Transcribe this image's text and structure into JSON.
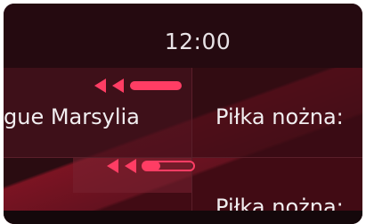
{
  "header": {
    "time": "12:00"
  },
  "programs": [
    {
      "title": "gue Marsylia",
      "status_icon": "rewind-icon",
      "progress": 1.0
    },
    {
      "title": "Piłka nożna:"
    },
    {
      "title": "Piłka nożna:",
      "status_icon": "rewind-icon",
      "progress": 0.2
    }
  ],
  "colors": {
    "accent": "#ff3d64",
    "background": "#2a0c11",
    "text": "#f1eef0"
  }
}
